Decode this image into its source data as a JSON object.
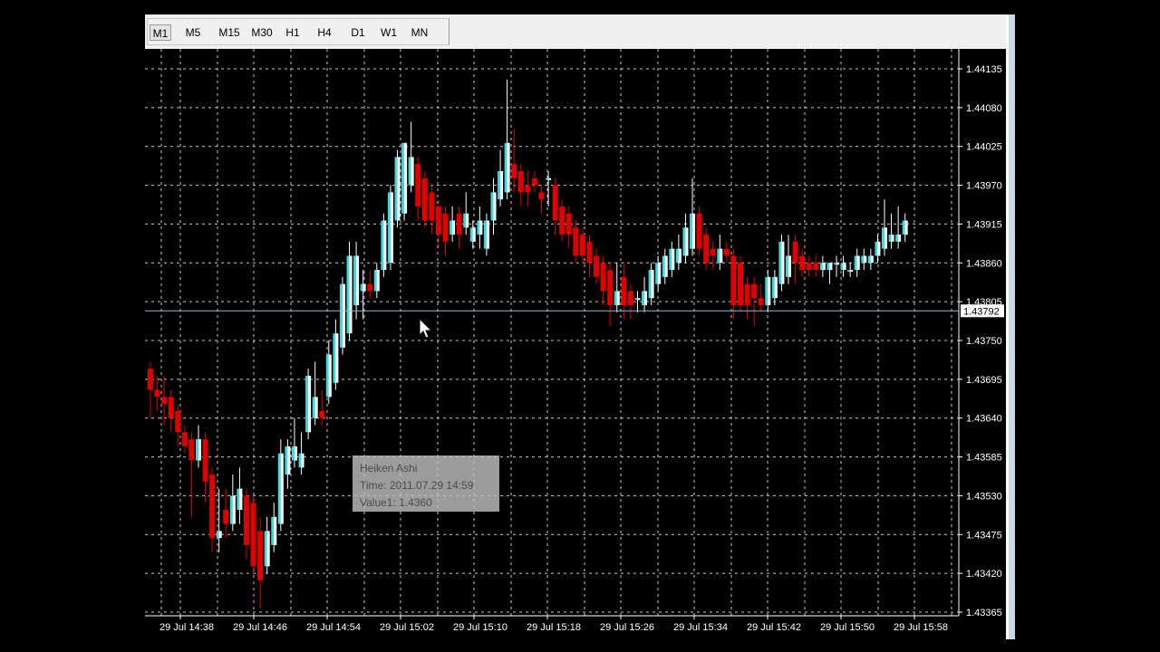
{
  "timeframes": [
    {
      "label": "M1",
      "active": true
    },
    {
      "label": "M5",
      "active": false
    },
    {
      "label": "M15",
      "active": false
    },
    {
      "label": "M30",
      "active": false
    },
    {
      "label": "H1",
      "active": false
    },
    {
      "label": "H4",
      "active": false
    },
    {
      "label": "D1",
      "active": false
    },
    {
      "label": "W1",
      "active": false
    },
    {
      "label": "MN",
      "active": false
    }
  ],
  "tooltip": {
    "line1": "Heiken Ashi",
    "line2": "Time: 2011.07.29 14:59",
    "line3": "Value1: 1.4360"
  },
  "colors": {
    "background": "#000000",
    "grid": "#c8c8c8",
    "axis_text": "#ffffff",
    "bear": "#e00000",
    "bull_body": "#ffffff",
    "bull_shade": "#3fd8e0",
    "wick": "#ffffff",
    "price_line": "#a0b4c8"
  },
  "chart_data": {
    "type": "candlestick",
    "indicator": "Heiken Ashi",
    "price_ticks": [
      1.44135,
      1.4408,
      1.44025,
      1.4397,
      1.43915,
      1.4386,
      1.43805,
      1.4375,
      1.43695,
      1.4364,
      1.43585,
      1.4353,
      1.43475,
      1.4342,
      1.43365
    ],
    "time_ticks": [
      "29 Jul 14:38",
      "29 Jul 14:46",
      "29 Jul 14:54",
      "29 Jul 15:02",
      "29 Jul 15:10",
      "29 Jul 15:18",
      "29 Jul 15:26",
      "29 Jul 15:34",
      "29 Jul 15:42",
      "29 Jul 15:50",
      "29 Jul 15:58"
    ],
    "current_price": "1.43792",
    "y_range": [
      1.4335,
      1.4415
    ],
    "grid": true,
    "candles": [
      {
        "o": 1.4371,
        "h": 1.4372,
        "l": 1.4364,
        "c": 1.4368
      },
      {
        "o": 1.4368,
        "h": 1.437,
        "l": 1.4365,
        "c": 1.4367
      },
      {
        "o": 1.4367,
        "h": 1.437,
        "l": 1.4363,
        "c": 1.4366
      },
      {
        "o": 1.4367,
        "h": 1.4368,
        "l": 1.4362,
        "c": 1.4364
      },
      {
        "o": 1.4365,
        "h": 1.4366,
        "l": 1.436,
        "c": 1.4362
      },
      {
        "o": 1.4362,
        "h": 1.4363,
        "l": 1.4359,
        "c": 1.436
      },
      {
        "o": 1.4361,
        "h": 1.4362,
        "l": 1.435,
        "c": 1.4358
      },
      {
        "o": 1.4358,
        "h": 1.4363,
        "l": 1.4357,
        "c": 1.4361
      },
      {
        "o": 1.4361,
        "h": 1.4362,
        "l": 1.4352,
        "c": 1.4355
      },
      {
        "o": 1.4356,
        "h": 1.4357,
        "l": 1.4345,
        "c": 1.4347
      },
      {
        "o": 1.4347,
        "h": 1.4354,
        "l": 1.4345,
        "c": 1.4348
      },
      {
        "o": 1.4351,
        "h": 1.4354,
        "l": 1.4347,
        "c": 1.4349
      },
      {
        "o": 1.4349,
        "h": 1.4356,
        "l": 1.4348,
        "c": 1.4353
      },
      {
        "o": 1.4351,
        "h": 1.4357,
        "l": 1.4349,
        "c": 1.4354
      },
      {
        "o": 1.4353,
        "h": 1.4354,
        "l": 1.4344,
        "c": 1.4346
      },
      {
        "o": 1.4352,
        "h": 1.4353,
        "l": 1.4342,
        "c": 1.4343
      },
      {
        "o": 1.4348,
        "h": 1.435,
        "l": 1.4337,
        "c": 1.4341
      },
      {
        "o": 1.4343,
        "h": 1.435,
        "l": 1.4342,
        "c": 1.4348
      },
      {
        "o": 1.4346,
        "h": 1.4352,
        "l": 1.4345,
        "c": 1.435
      },
      {
        "o": 1.4349,
        "h": 1.4361,
        "l": 1.4348,
        "c": 1.4359
      },
      {
        "o": 1.4356,
        "h": 1.4361,
        "l": 1.4354,
        "c": 1.436
      },
      {
        "o": 1.4358,
        "h": 1.4364,
        "l": 1.4357,
        "c": 1.436
      },
      {
        "o": 1.4357,
        "h": 1.4362,
        "l": 1.4356,
        "c": 1.4359
      },
      {
        "o": 1.4362,
        "h": 1.4371,
        "l": 1.4361,
        "c": 1.437
      },
      {
        "o": 1.4364,
        "h": 1.4372,
        "l": 1.4363,
        "c": 1.4367
      },
      {
        "o": 1.4365,
        "h": 1.4368,
        "l": 1.4363,
        "c": 1.4364
      },
      {
        "o": 1.4367,
        "h": 1.4375,
        "l": 1.4366,
        "c": 1.4373
      },
      {
        "o": 1.4369,
        "h": 1.4378,
        "l": 1.4368,
        "c": 1.4376
      },
      {
        "o": 1.4374,
        "h": 1.4384,
        "l": 1.4373,
        "c": 1.4383
      },
      {
        "o": 1.4376,
        "h": 1.4389,
        "l": 1.4375,
        "c": 1.4387
      },
      {
        "o": 1.438,
        "h": 1.4389,
        "l": 1.4378,
        "c": 1.4387
      },
      {
        "o": 1.4382,
        "h": 1.4385,
        "l": 1.4378,
        "c": 1.4383
      },
      {
        "o": 1.4383,
        "h": 1.4385,
        "l": 1.4381,
        "c": 1.4382
      },
      {
        "o": 1.4382,
        "h": 1.4386,
        "l": 1.4381,
        "c": 1.4385
      },
      {
        "o": 1.4385,
        "h": 1.4393,
        "l": 1.4384,
        "c": 1.4392
      },
      {
        "o": 1.4386,
        "h": 1.4397,
        "l": 1.4385,
        "c": 1.4396
      },
      {
        "o": 1.4392,
        "h": 1.4402,
        "l": 1.4391,
        "c": 1.4401
      },
      {
        "o": 1.4393,
        "h": 1.4403,
        "l": 1.4392,
        "c": 1.4403
      },
      {
        "o": 1.4397,
        "h": 1.4406,
        "l": 1.4396,
        "c": 1.4401
      },
      {
        "o": 1.44,
        "h": 1.4401,
        "l": 1.4392,
        "c": 1.4394
      },
      {
        "o": 1.4398,
        "h": 1.4399,
        "l": 1.4391,
        "c": 1.4392
      },
      {
        "o": 1.4396,
        "h": 1.4397,
        "l": 1.439,
        "c": 1.4392
      },
      {
        "o": 1.4394,
        "h": 1.4395,
        "l": 1.4388,
        "c": 1.439
      },
      {
        "o": 1.4393,
        "h": 1.4394,
        "l": 1.4387,
        "c": 1.4389
      },
      {
        "o": 1.439,
        "h": 1.4394,
        "l": 1.4389,
        "c": 1.4392
      },
      {
        "o": 1.4393,
        "h": 1.4394,
        "l": 1.4388,
        "c": 1.439
      },
      {
        "o": 1.4391,
        "h": 1.4396,
        "l": 1.439,
        "c": 1.4393
      },
      {
        "o": 1.4389,
        "h": 1.4392,
        "l": 1.4388,
        "c": 1.4391
      },
      {
        "o": 1.439,
        "h": 1.4394,
        "l": 1.4388,
        "c": 1.4392
      },
      {
        "o": 1.4388,
        "h": 1.4393,
        "l": 1.4387,
        "c": 1.4392
      },
      {
        "o": 1.4392,
        "h": 1.4398,
        "l": 1.439,
        "c": 1.4396
      },
      {
        "o": 1.4395,
        "h": 1.4402,
        "l": 1.4394,
        "c": 1.4399
      },
      {
        "o": 1.4396,
        "h": 1.4412,
        "l": 1.4395,
        "c": 1.4403
      },
      {
        "o": 1.44,
        "h": 1.4405,
        "l": 1.4396,
        "c": 1.4398
      },
      {
        "o": 1.4399,
        "h": 1.44,
        "l": 1.4394,
        "c": 1.4396
      },
      {
        "o": 1.4397,
        "h": 1.4399,
        "l": 1.4394,
        "c": 1.4396
      },
      {
        "o": 1.4398,
        "h": 1.4399,
        "l": 1.4396,
        "c": 1.4397
      },
      {
        "o": 1.4396,
        "h": 1.4397,
        "l": 1.4393,
        "c": 1.4395
      },
      {
        "o": 1.4398,
        "h": 1.4399,
        "l": 1.4394,
        "c": 1.4398
      },
      {
        "o": 1.4397,
        "h": 1.4398,
        "l": 1.439,
        "c": 1.4392
      },
      {
        "o": 1.4394,
        "h": 1.4395,
        "l": 1.4389,
        "c": 1.439
      },
      {
        "o": 1.4393,
        "h": 1.4394,
        "l": 1.4388,
        "c": 1.439
      },
      {
        "o": 1.4391,
        "h": 1.4392,
        "l": 1.4386,
        "c": 1.4387
      },
      {
        "o": 1.439,
        "h": 1.4391,
        "l": 1.4386,
        "c": 1.4387
      },
      {
        "o": 1.4389,
        "h": 1.439,
        "l": 1.4384,
        "c": 1.4386
      },
      {
        "o": 1.4387,
        "h": 1.4388,
        "l": 1.4383,
        "c": 1.4384
      },
      {
        "o": 1.4386,
        "h": 1.4387,
        "l": 1.438,
        "c": 1.4382
      },
      {
        "o": 1.4385,
        "h": 1.4386,
        "l": 1.4377,
        "c": 1.438
      },
      {
        "o": 1.438,
        "h": 1.4386,
        "l": 1.4379,
        "c": 1.4382
      },
      {
        "o": 1.4384,
        "h": 1.4386,
        "l": 1.4378,
        "c": 1.438
      },
      {
        "o": 1.4382,
        "h": 1.4383,
        "l": 1.4378,
        "c": 1.438
      },
      {
        "o": 1.4381,
        "h": 1.4382,
        "l": 1.4379,
        "c": 1.4381
      },
      {
        "o": 1.438,
        "h": 1.4384,
        "l": 1.4379,
        "c": 1.4382
      },
      {
        "o": 1.4381,
        "h": 1.4386,
        "l": 1.438,
        "c": 1.4385
      },
      {
        "o": 1.4383,
        "h": 1.4387,
        "l": 1.4382,
        "c": 1.4386
      },
      {
        "o": 1.4384,
        "h": 1.4388,
        "l": 1.4383,
        "c": 1.4387
      },
      {
        "o": 1.4385,
        "h": 1.4389,
        "l": 1.4384,
        "c": 1.4388
      },
      {
        "o": 1.4386,
        "h": 1.439,
        "l": 1.4385,
        "c": 1.4388
      },
      {
        "o": 1.4387,
        "h": 1.4393,
        "l": 1.4386,
        "c": 1.4391
      },
      {
        "o": 1.4388,
        "h": 1.4398,
        "l": 1.4387,
        "c": 1.4393
      },
      {
        "o": 1.4393,
        "h": 1.4394,
        "l": 1.4387,
        "c": 1.4388
      },
      {
        "o": 1.439,
        "h": 1.4391,
        "l": 1.4385,
        "c": 1.4386
      },
      {
        "o": 1.4388,
        "h": 1.4389,
        "l": 1.4385,
        "c": 1.4387
      },
      {
        "o": 1.4386,
        "h": 1.439,
        "l": 1.4385,
        "c": 1.4388
      },
      {
        "o": 1.4388,
        "h": 1.4389,
        "l": 1.4386,
        "c": 1.4387
      },
      {
        "o": 1.4387,
        "h": 1.4388,
        "l": 1.4378,
        "c": 1.438
      },
      {
        "o": 1.4386,
        "h": 1.4387,
        "l": 1.4379,
        "c": 1.438
      },
      {
        "o": 1.4383,
        "h": 1.4384,
        "l": 1.4378,
        "c": 1.438
      },
      {
        "o": 1.4383,
        "h": 1.4384,
        "l": 1.4377,
        "c": 1.4381
      },
      {
        "o": 1.4381,
        "h": 1.4383,
        "l": 1.4379,
        "c": 1.438
      },
      {
        "o": 1.438,
        "h": 1.4385,
        "l": 1.4379,
        "c": 1.4384
      },
      {
        "o": 1.4381,
        "h": 1.4385,
        "l": 1.438,
        "c": 1.4384
      },
      {
        "o": 1.4383,
        "h": 1.439,
        "l": 1.4382,
        "c": 1.4389
      },
      {
        "o": 1.4384,
        "h": 1.439,
        "l": 1.4383,
        "c": 1.4387
      },
      {
        "o": 1.4389,
        "h": 1.439,
        "l": 1.4383,
        "c": 1.4386
      },
      {
        "o": 1.4387,
        "h": 1.4388,
        "l": 1.4384,
        "c": 1.4385
      },
      {
        "o": 1.4386,
        "h": 1.4387,
        "l": 1.4384,
        "c": 1.4385
      },
      {
        "o": 1.4386,
        "h": 1.4387,
        "l": 1.4384,
        "c": 1.4385
      },
      {
        "o": 1.4385,
        "h": 1.4387,
        "l": 1.4384,
        "c": 1.4386
      },
      {
        "o": 1.4385,
        "h": 1.4386,
        "l": 1.4383,
        "c": 1.4386
      },
      {
        "o": 1.4386,
        "h": 1.4387,
        "l": 1.4384,
        "c": 1.4386
      },
      {
        "o": 1.4385,
        "h": 1.4387,
        "l": 1.4384,
        "c": 1.4386
      },
      {
        "o": 1.4385,
        "h": 1.4386,
        "l": 1.4384,
        "c": 1.4385
      },
      {
        "o": 1.4385,
        "h": 1.4388,
        "l": 1.4384,
        "c": 1.4387
      },
      {
        "o": 1.4386,
        "h": 1.4388,
        "l": 1.4385,
        "c": 1.4387
      },
      {
        "o": 1.4386,
        "h": 1.4388,
        "l": 1.4385,
        "c": 1.4387
      },
      {
        "o": 1.4387,
        "h": 1.439,
        "l": 1.4386,
        "c": 1.4389
      },
      {
        "o": 1.4388,
        "h": 1.4395,
        "l": 1.4387,
        "c": 1.4391
      },
      {
        "o": 1.4389,
        "h": 1.4393,
        "l": 1.4388,
        "c": 1.439
      },
      {
        "o": 1.4389,
        "h": 1.4394,
        "l": 1.4388,
        "c": 1.439
      },
      {
        "o": 1.439,
        "h": 1.4393,
        "l": 1.4389,
        "c": 1.4392
      }
    ]
  }
}
